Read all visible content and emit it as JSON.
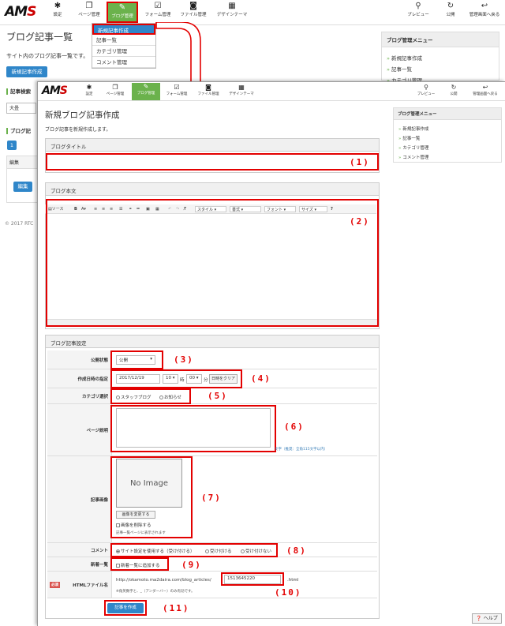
{
  "app": {
    "logo": "AMS",
    "nav": [
      {
        "label": "設定",
        "icon": "gear-icon",
        "glyph": "✱"
      },
      {
        "label": "ページ管理",
        "icon": "pages-icon",
        "glyph": "❐"
      },
      {
        "label": "ブログ管理",
        "icon": "blog-edit-icon",
        "glyph": "✎"
      },
      {
        "label": "フォーム管理",
        "icon": "form-icon",
        "glyph": "☑"
      },
      {
        "label": "ファイル管理",
        "icon": "camera-icon",
        "glyph": "◙"
      },
      {
        "label": "デザインテーマ",
        "icon": "design-icon",
        "glyph": "▦"
      }
    ],
    "right_nav": [
      {
        "label": "プレビュー",
        "icon": "search-icon",
        "glyph": "⚲"
      },
      {
        "label": "公開",
        "icon": "refresh-icon",
        "glyph": "↻"
      },
      {
        "label": "管理画面へ戻る",
        "icon": "return-icon",
        "glyph": "↩"
      }
    ]
  },
  "background": {
    "title": "ブログ記事一覧",
    "description": "サイト内のブログ記事一覧です。",
    "new_button": "新規記事作成",
    "search_label": "記事検索",
    "search_select": "大畳",
    "list_label": "ブログ記",
    "page_num": "1",
    "col_edit": "編集",
    "edit_button": "編集",
    "footer": "© 2017 RTC",
    "dropdown": [
      "新規記事作成",
      "記事一覧",
      "カテゴリ管理",
      "コメント管理"
    ],
    "side_title": "ブログ管理メニュー",
    "side_items": [
      "新規記事作成",
      "記事一覧",
      "カテゴリ管理"
    ]
  },
  "form": {
    "title": "新規ブログ記事作成",
    "description": "ブログ記事を新規作成します。",
    "blog_title_header": "ブログタイトル",
    "blog_body_header": "ブログ本文",
    "settings_header": "ブログ記事設定",
    "toolbar": {
      "source": "ソース",
      "style": "スタイル",
      "format": "書式",
      "font": "フォント",
      "size": "サイズ",
      "help": "?"
    },
    "status_label": "公開状態",
    "status_value": "公開",
    "date_label": "作成日時の指定",
    "date_value": "2017/12/19",
    "hour_value": "10",
    "hour_unit": "時",
    "minute_value": "00",
    "minute_unit": "分",
    "date_clear": "日時をクリア",
    "category_label": "カテゴリ選択",
    "category_options": [
      "スタッフブログ",
      "お知らせ"
    ],
    "description_label": "ページ説明",
    "description_hint": "文字（推奨：全角115文字以内）",
    "image_label": "記事画像",
    "no_image": "No Image",
    "change_image": "画像を変更する",
    "delete_image": "画像を削除する",
    "image_note": "記事一覧ページに表示されます",
    "comment_label": "コメント",
    "comment_options": [
      "サイト設定を使用する（受け付ける）",
      "受け付ける",
      "受け付けない"
    ],
    "newlist_label": "新着一覧",
    "newlist_option": "新着一覧に追加する",
    "required": "必須",
    "html_label": "HTMLファイル名",
    "url_prefix": "http://okamoto.ma2daira.com/blog_articles/",
    "filename": "1513645220",
    "ext": ".html",
    "html_note": "※角英数字と、_（アンダーバー）のみ有効です。",
    "submit": "記事を作成",
    "help_button": "ヘルプ",
    "side_title": "ブログ管理メニュー",
    "side_items": [
      "新規記事作成",
      "記事一覧",
      "カテゴリ管理",
      "コメント管理"
    ]
  },
  "annotations": [
    "(1)",
    "(2)",
    "(3)",
    "(4)",
    "(5)",
    "(6)",
    "(7)",
    "(8)",
    "(9)",
    "(10)",
    "(11)"
  ],
  "colors": {
    "accent_green": "#6bb24c",
    "button_blue": "#2f86c9",
    "annotation_red": "#e30000"
  }
}
